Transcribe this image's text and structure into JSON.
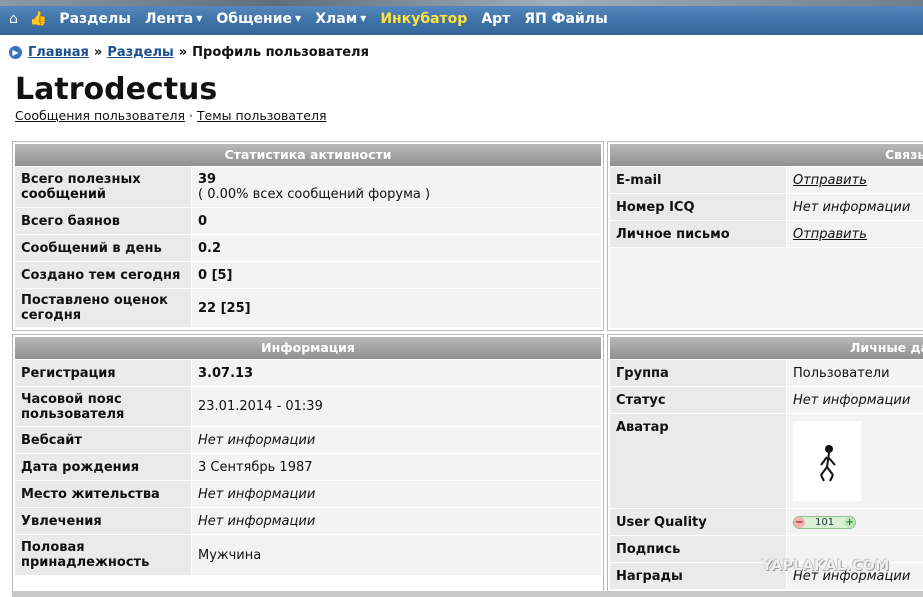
{
  "nav": {
    "items": [
      {
        "label": "Разделы",
        "dropdown": false
      },
      {
        "label": "Лента",
        "dropdown": true
      },
      {
        "label": "Общение",
        "dropdown": true
      },
      {
        "label": "Хлам",
        "dropdown": true
      },
      {
        "label": "Инкубатор",
        "dropdown": false,
        "highlight": true
      },
      {
        "label": "Арт",
        "dropdown": false
      },
      {
        "label": "ЯП Файлы",
        "dropdown": false
      }
    ]
  },
  "breadcrumb": {
    "home": "Главная",
    "sep": "»",
    "sections": "Разделы",
    "current": "Профиль пользователя"
  },
  "profile": {
    "username": "Latrodectus",
    "link_posts": "Сообщения пользователя",
    "link_sep": "·",
    "link_topics": "Темы пользователя"
  },
  "stats": {
    "title": "Статистика активности",
    "rows": [
      {
        "label": "Всего полезных сообщений",
        "value": "39",
        "value2": "( 0.00% всех сообщений форума )"
      },
      {
        "label": "Всего баянов",
        "value": "0"
      },
      {
        "label": "Сообщений в день",
        "value": "0.2"
      },
      {
        "label": "Создано тем сегодня",
        "value": "0 [5]"
      },
      {
        "label": "Поставлено оценок сегодня",
        "value": "22 [25]"
      }
    ]
  },
  "contacts": {
    "title": "Связь",
    "rows": [
      {
        "label": "E-mail",
        "value": "Отправить"
      },
      {
        "label": "Номер ICQ",
        "value": "Нет информации"
      },
      {
        "label": "Личное письмо",
        "value": "Отправить"
      }
    ]
  },
  "info": {
    "title": "Информация",
    "rows": [
      {
        "label": "Регистрация",
        "value": "3.07.13"
      },
      {
        "label": "Часовой пояс пользователя",
        "value": "23.01.2014 - 01:39"
      },
      {
        "label": "Вебсайт",
        "value": "Нет информации"
      },
      {
        "label": "Дата рождения",
        "value": "3 Сентябрь 1987"
      },
      {
        "label": "Место жительства",
        "value": "Нет информации"
      },
      {
        "label": "Увлечения",
        "value": "Нет информации"
      },
      {
        "label": "Половая принадлежность",
        "value": "Мужчина"
      }
    ]
  },
  "personal": {
    "title": "Личные да",
    "rows": [
      {
        "label": "Группа",
        "value": "Пользователи"
      },
      {
        "label": "Статус",
        "value": "Нет информации"
      },
      {
        "label": "Аватар",
        "value": ""
      },
      {
        "label": "User Quality",
        "value": "101",
        "minus": "−",
        "plus": "+"
      },
      {
        "label": "Подпись",
        "value": ""
      },
      {
        "label": "Награды",
        "value": "Нет информации"
      }
    ]
  },
  "watermark": "YAPLAKAL.COM",
  "icons": {
    "home": "home-icon",
    "thumb": "thumbs-up-icon",
    "crumb": "play-circle-icon"
  }
}
